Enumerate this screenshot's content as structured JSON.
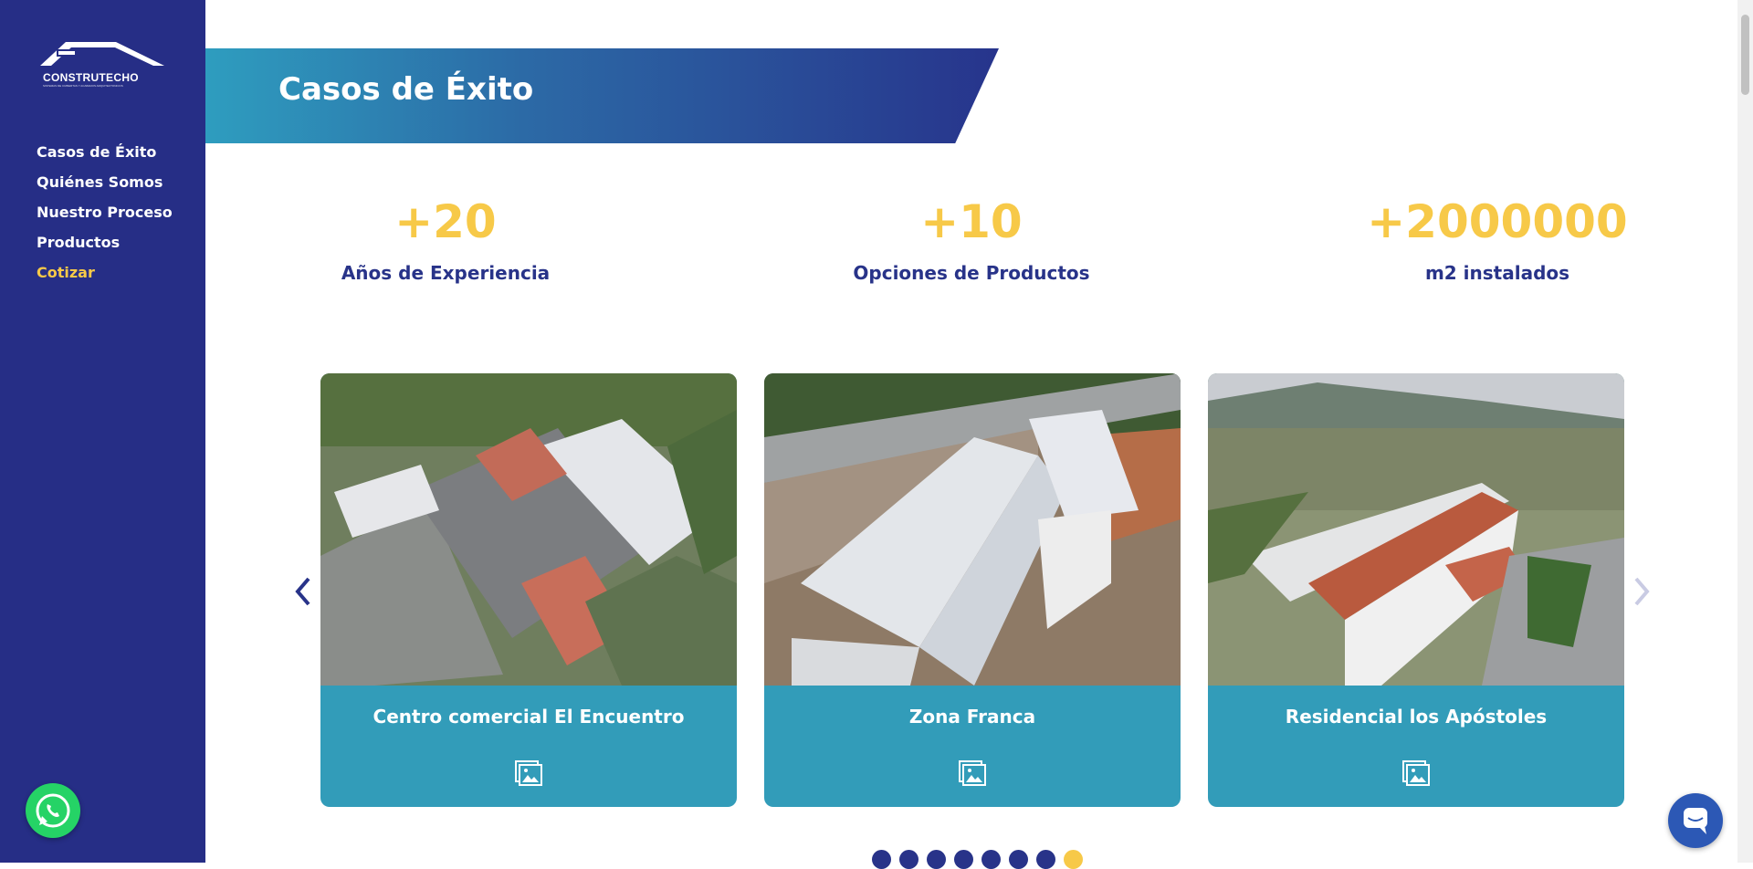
{
  "brand": {
    "name": "CONSTRUTECHO",
    "tagline": "SISTEMAS DE CUBIERTAS Y ACABADOS ARQUITECTONICOS"
  },
  "nav": {
    "items": [
      {
        "label": "Casos de Éxito"
      },
      {
        "label": "Quiénes Somos"
      },
      {
        "label": "Nuestro Proceso"
      },
      {
        "label": "Productos"
      },
      {
        "label": "Cotizar"
      }
    ],
    "active_index": 4
  },
  "banner": {
    "title": "Casos de Éxito"
  },
  "stats": [
    {
      "value": "+20",
      "label": "Años de Experiencia"
    },
    {
      "value": "+10",
      "label": "Opciones de Productos"
    },
    {
      "value": "+2000000",
      "label": "m2 instalados"
    }
  ],
  "cards": [
    {
      "title": "Centro comercial El Encuentro",
      "icon": "gallery-icon"
    },
    {
      "title": "Zona Franca",
      "icon": "gallery-icon"
    },
    {
      "title": "Residencial los Apóstoles",
      "icon": "gallery-icon"
    }
  ],
  "carousel": {
    "page_count": 8,
    "active_page": 8
  },
  "colors": {
    "sidebar": "#262e86",
    "accent_yellow": "#f7c948",
    "card_teal": "#329cb9",
    "navy_text": "#283389"
  }
}
